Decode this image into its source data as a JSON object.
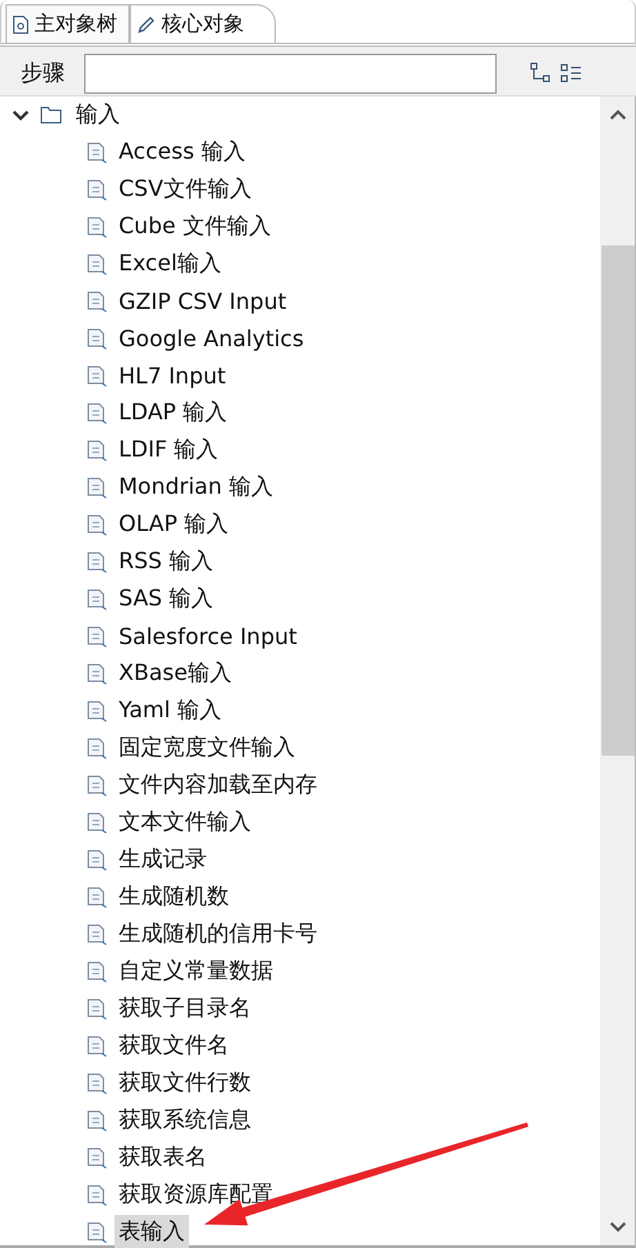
{
  "tabs": [
    {
      "label": "主对象树",
      "selected": false
    },
    {
      "label": "核心对象",
      "selected": true
    }
  ],
  "toolbar": {
    "label": "步骤"
  },
  "tree": [
    {
      "label": "输入",
      "expanded": true,
      "children": [
        {
          "label": "Access 输入",
          "selected": false
        },
        {
          "label": "CSV文件输入",
          "selected": false
        },
        {
          "label": "Cube 文件输入",
          "selected": false
        },
        {
          "label": "Excel输入",
          "selected": false
        },
        {
          "label": "GZIP CSV Input",
          "selected": false
        },
        {
          "label": "Google Analytics",
          "selected": false
        },
        {
          "label": "HL7 Input",
          "selected": false
        },
        {
          "label": "LDAP 输入",
          "selected": false
        },
        {
          "label": "LDIF 输入",
          "selected": false
        },
        {
          "label": "Mondrian 输入",
          "selected": false
        },
        {
          "label": "OLAP 输入",
          "selected": false
        },
        {
          "label": "RSS 输入",
          "selected": false
        },
        {
          "label": "SAS 输入",
          "selected": false
        },
        {
          "label": "Salesforce Input",
          "selected": false
        },
        {
          "label": "XBase输入",
          "selected": false
        },
        {
          "label": "Yaml 输入",
          "selected": false
        },
        {
          "label": "固定宽度文件输入",
          "selected": false
        },
        {
          "label": "文件内容加载至内存",
          "selected": false
        },
        {
          "label": "文本文件输入",
          "selected": false
        },
        {
          "label": "生成记录",
          "selected": false
        },
        {
          "label": "生成随机数",
          "selected": false
        },
        {
          "label": "生成随机的信用卡号",
          "selected": false
        },
        {
          "label": "自定义常量数据",
          "selected": false
        },
        {
          "label": "获取子目录名",
          "selected": false
        },
        {
          "label": "获取文件名",
          "selected": false
        },
        {
          "label": "获取文件行数",
          "selected": false
        },
        {
          "label": "获取系统信息",
          "selected": false
        },
        {
          "label": "获取表名",
          "selected": false
        },
        {
          "label": "获取资源库配置",
          "selected": false
        },
        {
          "label": "表输入",
          "selected": true
        }
      ]
    }
  ]
}
